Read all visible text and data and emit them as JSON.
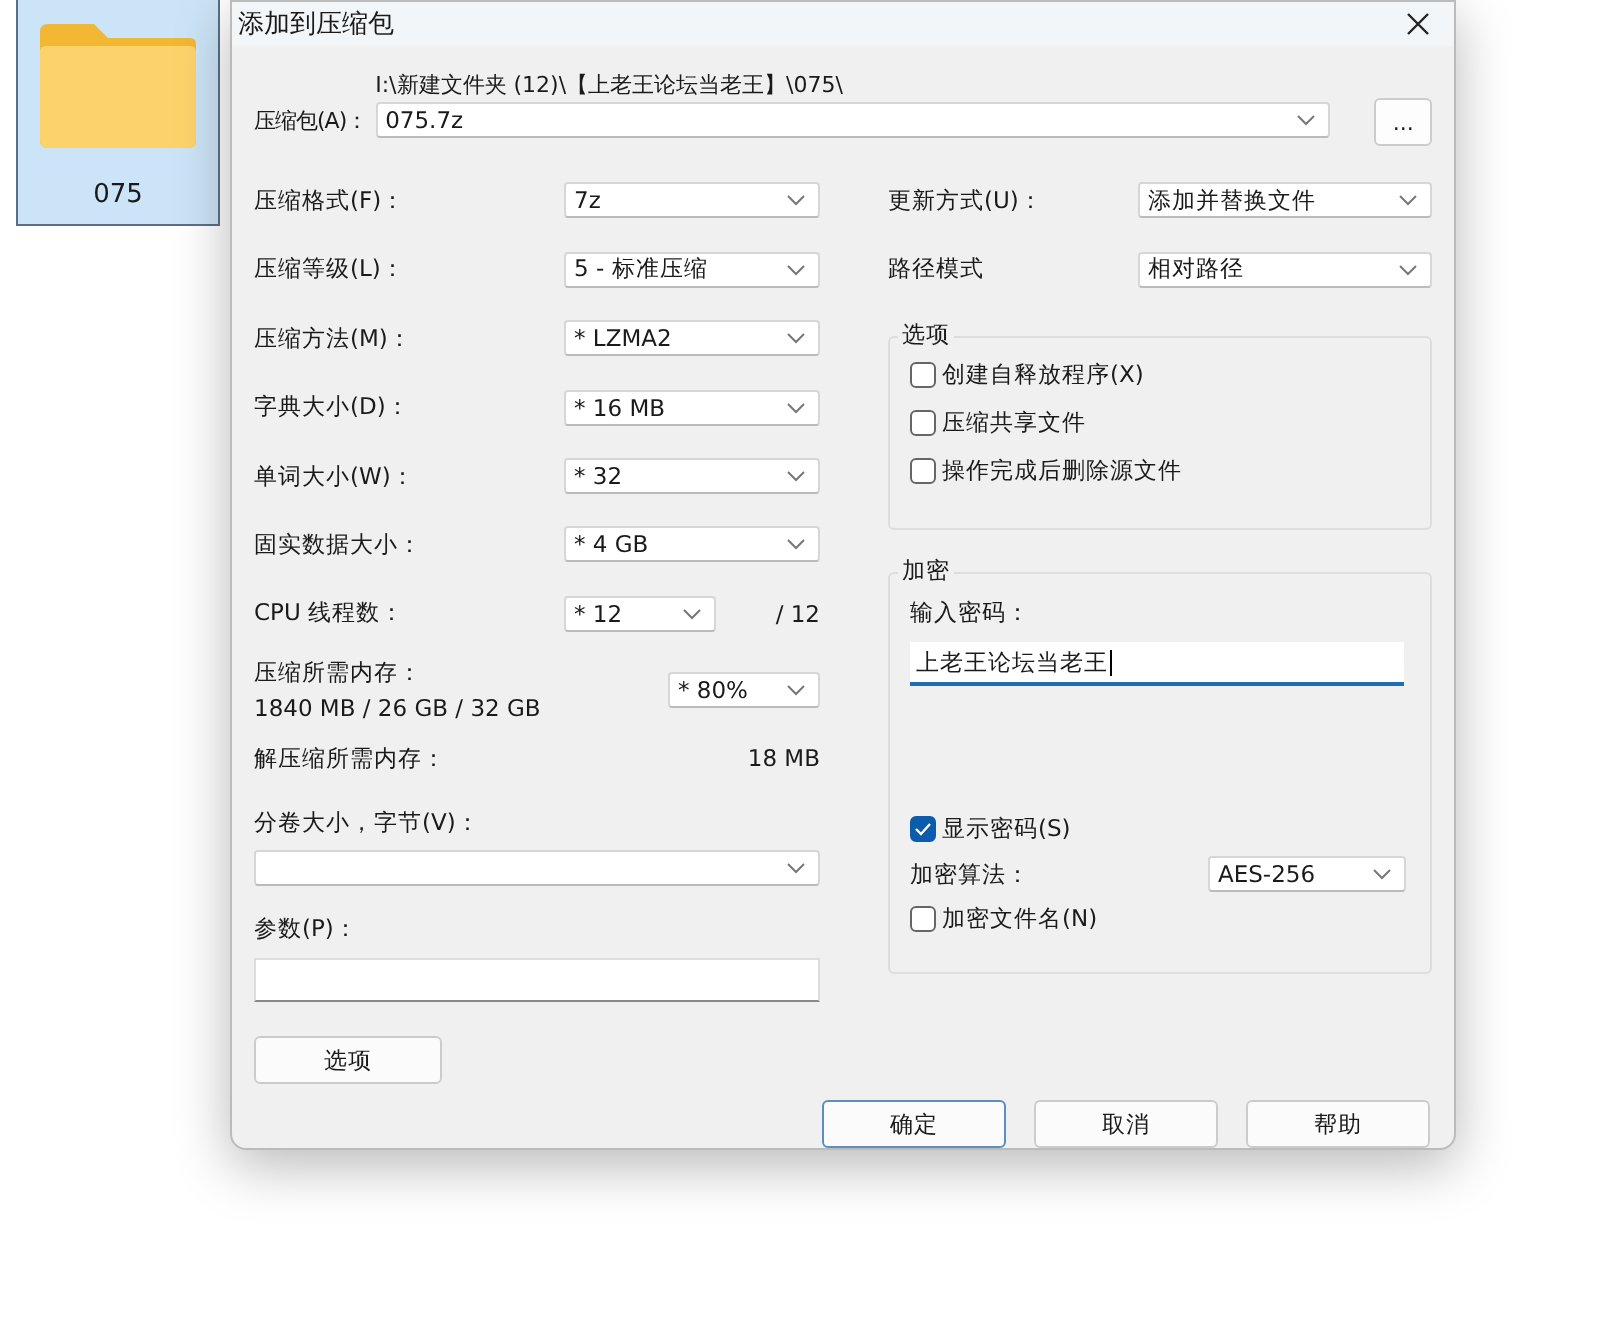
{
  "desktop_item": {
    "label": "075",
    "selected": true
  },
  "window": {
    "title": "添加到压缩包"
  },
  "archive": {
    "label": "压缩包(A)：",
    "path": "I:\\新建文件夹 (12)\\【上老王论坛当老王】\\075\\",
    "value": "075.7z",
    "browse": "..."
  },
  "left_rows": [
    {
      "kind": "combo",
      "label": "压缩格式(F)：",
      "value": "7z"
    },
    {
      "kind": "combo",
      "label": "压缩等级(L)：",
      "value": "5 - 标准压缩"
    },
    {
      "kind": "combo",
      "label": "压缩方法(M)：",
      "value": "*  LZMA2"
    },
    {
      "kind": "combo",
      "label": "字典大小(D)：",
      "value": "*  16 MB"
    },
    {
      "kind": "combo",
      "label": "单词大小(W)：",
      "value": "*  32"
    },
    {
      "kind": "combo",
      "label": "固实数据大小：",
      "value": "*  4 GB"
    },
    {
      "kind": "combo_suffix",
      "label": "CPU 线程数：",
      "value": "*  12",
      "suffix": "/ 12"
    },
    {
      "kind": "memory",
      "label": "压缩所需内存：",
      "detail": "1840 MB / 26 GB / 32 GB",
      "value": "*  80%"
    },
    {
      "kind": "reading",
      "label": "解压缩所需内存：",
      "reading": "18 MB"
    }
  ],
  "volume": {
    "label": "分卷大小，字节(V)："
  },
  "parameters": {
    "label": "参数(P)："
  },
  "options_button": "选项",
  "right_rows": [
    {
      "label": "更新方式(U)：",
      "value": "添加并替换文件"
    },
    {
      "label": "路径模式",
      "value": "相对路径"
    }
  ],
  "options_group": {
    "title": "选项",
    "checkboxes": [
      {
        "label": "创建自释放程序(X)",
        "checked": false
      },
      {
        "label": "压缩共享文件",
        "checked": false
      },
      {
        "label": "操作完成后删除源文件",
        "checked": false
      }
    ]
  },
  "encryption": {
    "title": "加密",
    "password_label": "输入密码：",
    "password_value": "上老王论坛当老王",
    "show_password": {
      "label": "显示密码(S)",
      "checked": true
    },
    "method_label": "加密算法：",
    "method_value": "AES-256",
    "encrypt_names": {
      "label": "加密文件名(N)",
      "checked": false
    }
  },
  "buttons": [
    {
      "label": "确定",
      "focused": true
    },
    {
      "label": "取消",
      "focused": false
    },
    {
      "label": "帮助",
      "focused": false
    }
  ]
}
